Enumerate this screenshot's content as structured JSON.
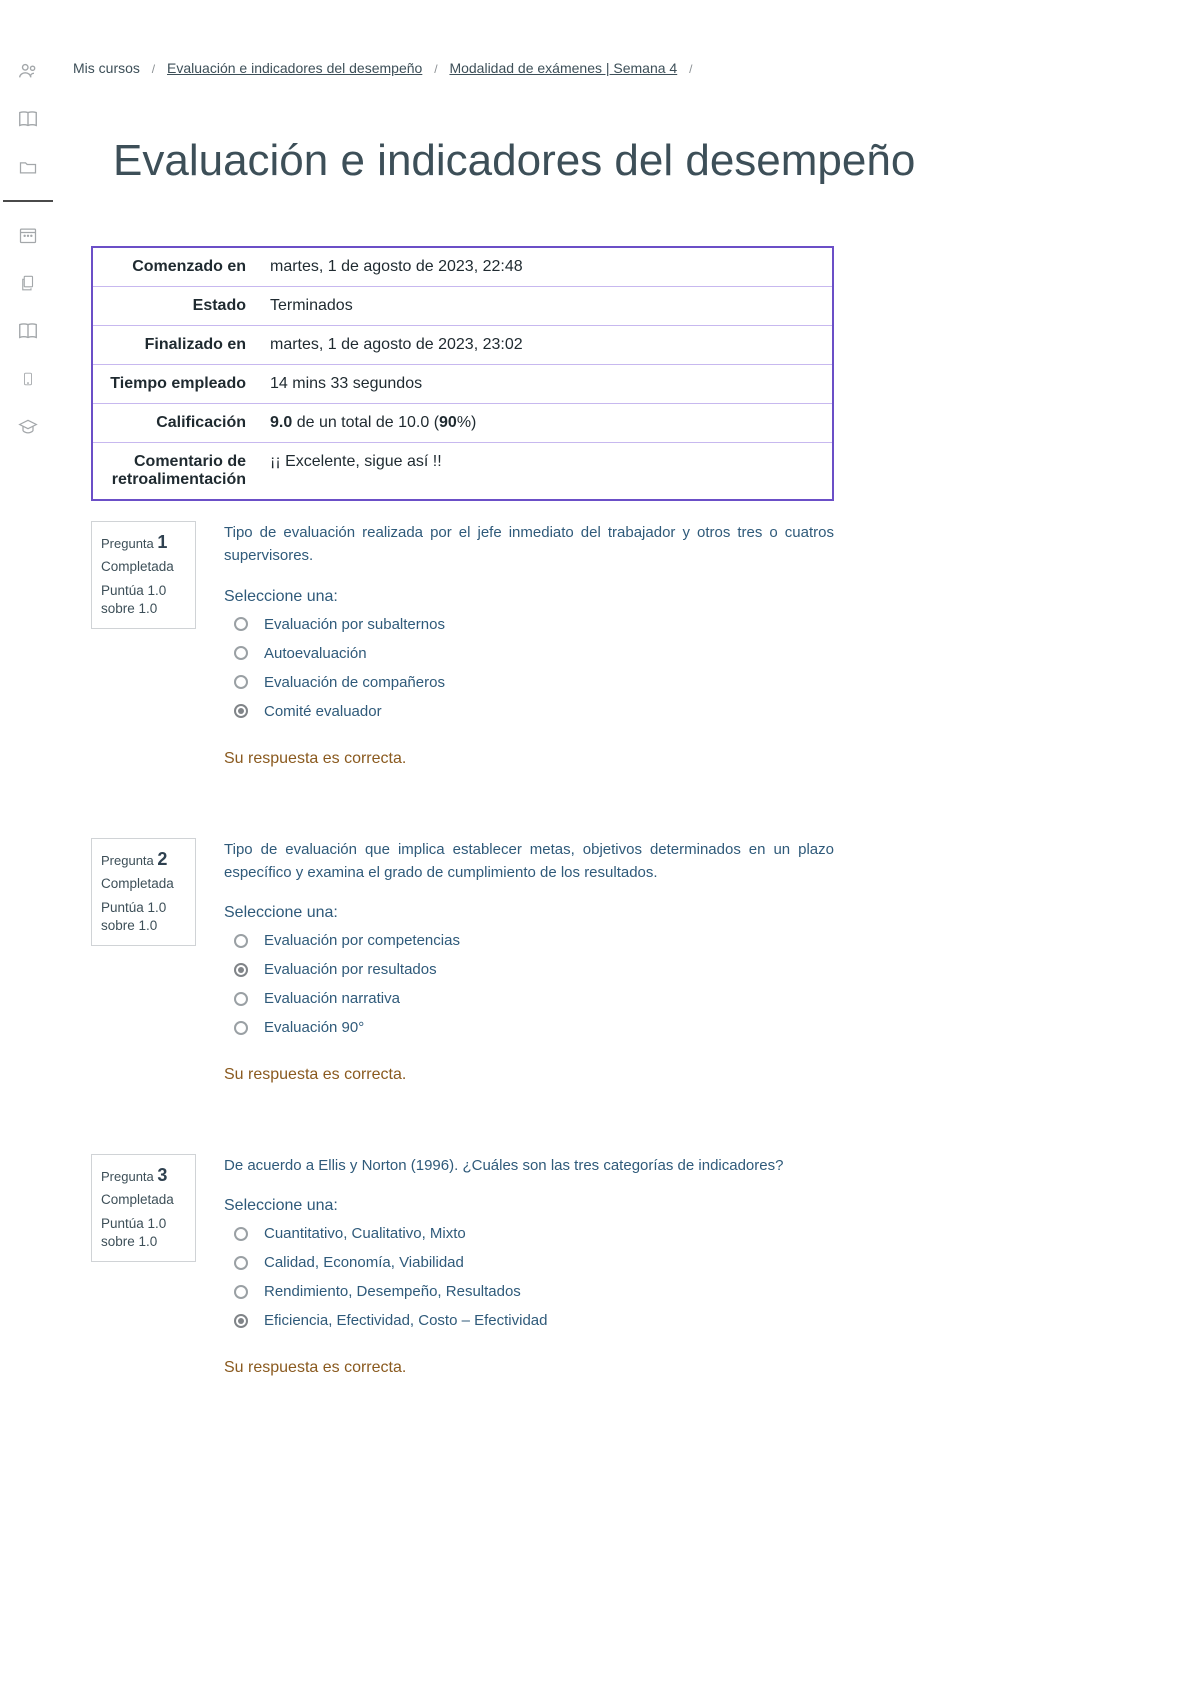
{
  "breadcrumbs": {
    "item1": "Mis cursos",
    "item2": "Evaluación e indicadores del desempeño",
    "item3": "Modalidad de exámenes | Semana 4"
  },
  "page_title": "Evaluación e indicadores del desempeño",
  "summary": {
    "rows": [
      {
        "label": "Comenzado en",
        "value_html": "martes, 1 de agosto de 2023, 22:48"
      },
      {
        "label": "Estado",
        "value_html": "Terminados"
      },
      {
        "label": "Finalizado en",
        "value_html": "martes, 1 de agosto de 2023, 23:02"
      },
      {
        "label": "Tiempo empleado",
        "value_html": "14 mins 33 segundos"
      },
      {
        "label": "Calificación",
        "value_html": "<span class='b'>9.0</span> de un total de 10.0 (<span class='b'>90</span>%)"
      },
      {
        "label": "Comentario de retroalimentación",
        "value_html": "¡¡ Excelente, sigue así !!"
      }
    ]
  },
  "strings": {
    "pregunta": "Pregunta",
    "seleccione": "Seleccione una:",
    "correcta": "Su respuesta es correcta."
  },
  "questions": [
    {
      "number": "1",
      "status": "Completada",
      "points": "Puntúa 1.0 sobre 1.0",
      "prompt": "Tipo de evaluación realizada por el jefe inmediato del trabajador y otros tres o cuatros supervisores.",
      "options": [
        {
          "text": "Evaluación por subalternos",
          "selected": false
        },
        {
          "text": "Autoevaluación",
          "selected": false
        },
        {
          "text": "Evaluación de compañeros",
          "selected": false
        },
        {
          "text": "Comité evaluador",
          "selected": true
        }
      ]
    },
    {
      "number": "2",
      "status": "Completada",
      "points": "Puntúa 1.0 sobre 1.0",
      "prompt": "Tipo de evaluación que implica establecer metas, objetivos determinados en un plazo específico y examina el grado de cumplimiento de los resultados.",
      "options": [
        {
          "text": "Evaluación por competencias",
          "selected": false
        },
        {
          "text": "Evaluación por resultados",
          "selected": true
        },
        {
          "text": "Evaluación narrativa",
          "selected": false
        },
        {
          "text": "Evaluación 90°",
          "selected": false
        }
      ]
    },
    {
      "number": "3",
      "status": "Completada",
      "points": "Puntúa 1.0 sobre 1.0",
      "prompt": "De acuerdo a Ellis y Norton (1996). ¿Cuáles son las tres categorías de indicadores?",
      "options": [
        {
          "text": "Cuantitativo, Cualitativo, Mixto",
          "selected": false
        },
        {
          "text": "Calidad, Economía, Viabilidad",
          "selected": false
        },
        {
          "text": "Rendimiento, Desempeño, Resultados",
          "selected": false
        },
        {
          "text": "Eficiencia, Efectividad, Costo – Efectividad",
          "selected": true
        }
      ]
    }
  ]
}
